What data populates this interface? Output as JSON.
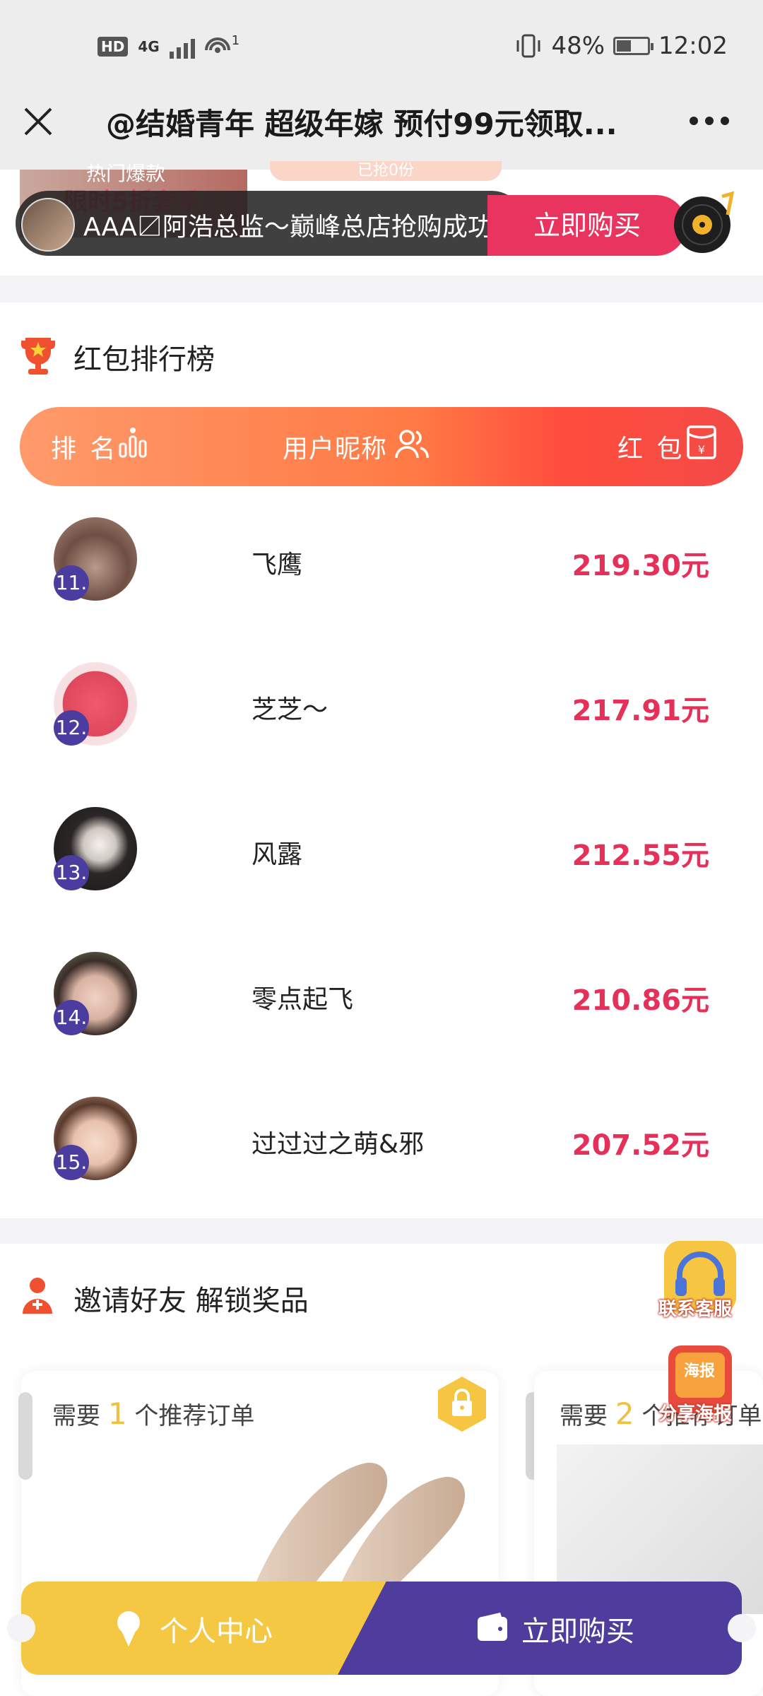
{
  "status_bar": {
    "hd": "HD",
    "network": "4G",
    "wifi_count": "1",
    "battery_level": 0.48,
    "battery": "48%",
    "time": "12:02"
  },
  "title_bar": {
    "title": "@结婚青年 超级年嫁 预付99元领取..."
  },
  "banner": {
    "hot_label": "热门爆款",
    "hot_sub": "限时5折套系",
    "grabbed": "已抢0份",
    "toast_text": "AAA〼阿浩总监～巅峰总店抢购成功",
    "buy_now": "立即购买"
  },
  "ranking": {
    "title": "红包排行榜",
    "col_rank": "排 名",
    "col_user": "用户昵称",
    "col_bonus": "红 包",
    "rows": [
      {
        "rank": "11.",
        "name": "飞鹰",
        "amount": "219.30元"
      },
      {
        "rank": "12.",
        "name": "芝芝～",
        "amount": "217.91元"
      },
      {
        "rank": "13.",
        "name": "风露",
        "amount": "212.55元"
      },
      {
        "rank": "14.",
        "name": "零点起飞",
        "amount": "210.86元"
      },
      {
        "rank": "15.",
        "name": "过过过之萌&邪",
        "amount": "207.52元"
      }
    ]
  },
  "invite": {
    "title": "邀请好友 解锁奖品",
    "card1_prefix": "需要",
    "card1_num": "1",
    "card1_suffix": "个推荐订单",
    "card2_prefix": "需要",
    "card2_num": "2",
    "card2_suffix": "个推荐订单"
  },
  "floating": {
    "contact": "联系客服",
    "poster_badge": "海报",
    "poster": "分享海报"
  },
  "bottom_bar": {
    "personal": "个人中心",
    "buy": "立即购买"
  },
  "colors": {
    "accent_red": "#e5305a",
    "header_orange": "#ff7a45",
    "purple": "#4e3d9d",
    "yellow": "#f5c843"
  }
}
